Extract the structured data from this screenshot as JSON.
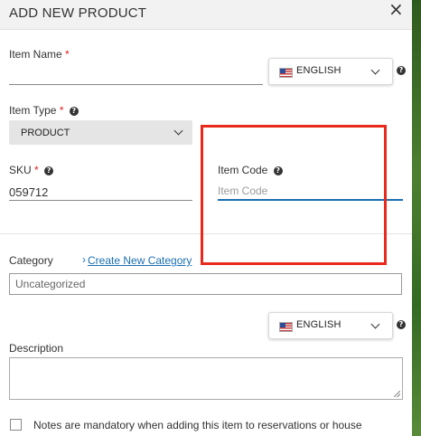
{
  "modal": {
    "title": "ADD NEW PRODUCT",
    "close_icon": "×"
  },
  "item_name": {
    "label": "Item Name",
    "required_mark": "*",
    "value": "",
    "language": {
      "flag_icon": "us-flag-icon",
      "label": "ENGLISH"
    },
    "help_icon": "?"
  },
  "item_type": {
    "label": "Item Type",
    "required_mark": "*",
    "help_icon": "?",
    "selected": "PRODUCT"
  },
  "sku": {
    "label": "SKU",
    "required_mark": "*",
    "help_icon": "?",
    "value": "059712"
  },
  "item_code": {
    "label": "Item Code",
    "help_icon": "?",
    "value": "",
    "placeholder": "Item Code"
  },
  "category": {
    "label": "Category",
    "link_prefix": "›",
    "create_link": "Create New Category",
    "value": "Uncategorized"
  },
  "description": {
    "label": "Description",
    "language": {
      "flag_icon": "us-flag-icon",
      "label": "ENGLISH"
    },
    "help_icon": "?",
    "value": ""
  },
  "notes_mandatory": {
    "checked": false,
    "label": "Notes are mandatory when adding this item to reservations or house"
  },
  "highlight": {
    "color": "#e82a1d"
  },
  "colors": {
    "accent": "#1a6fb0",
    "required": "#e02020"
  }
}
